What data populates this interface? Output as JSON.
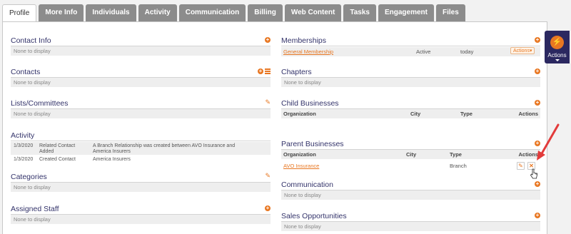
{
  "tabs": [
    "Profile",
    "More Info",
    "Individuals",
    "Activity",
    "Communication",
    "Billing",
    "Web Content",
    "Tasks",
    "Engagement",
    "Files"
  ],
  "none_text": "None to display",
  "left": {
    "contact_info": {
      "title": "Contact Info"
    },
    "contacts": {
      "title": "Contacts"
    },
    "lists": {
      "title": "Lists/Committees"
    },
    "activity": {
      "title": "Activity",
      "rows": [
        {
          "date": "1/3/2020",
          "type": "Related Contact Added",
          "desc": "A Branch Relationship was created between AVO Insurance and America Insurers"
        },
        {
          "date": "1/3/2020",
          "type": "Created Contact",
          "desc": "America Insurers"
        }
      ]
    },
    "categories": {
      "title": "Categories"
    },
    "staff": {
      "title": "Assigned Staff"
    }
  },
  "right": {
    "memberships": {
      "title": "Memberships",
      "row": {
        "name": "General Membership",
        "status": "Active",
        "date": "today",
        "actions": "Actions▾"
      }
    },
    "chapters": {
      "title": "Chapters"
    },
    "child": {
      "title": "Child Businesses",
      "headers": {
        "org": "Organization",
        "city": "City",
        "type": "Type",
        "actions": "Actions"
      }
    },
    "parent": {
      "title": "Parent Businesses",
      "headers": {
        "org": "Organization",
        "city": "City",
        "type": "Type",
        "actions": "Actions"
      },
      "row": {
        "org": "AVO Insurance",
        "type": "Branch"
      }
    },
    "communication": {
      "title": "Communication"
    },
    "sales": {
      "title": "Sales Opportunities"
    }
  },
  "actions_widget": {
    "label": "Actions"
  },
  "colors": {
    "accent": "#e87722",
    "title": "#33336a",
    "widget": "#2b2860"
  }
}
